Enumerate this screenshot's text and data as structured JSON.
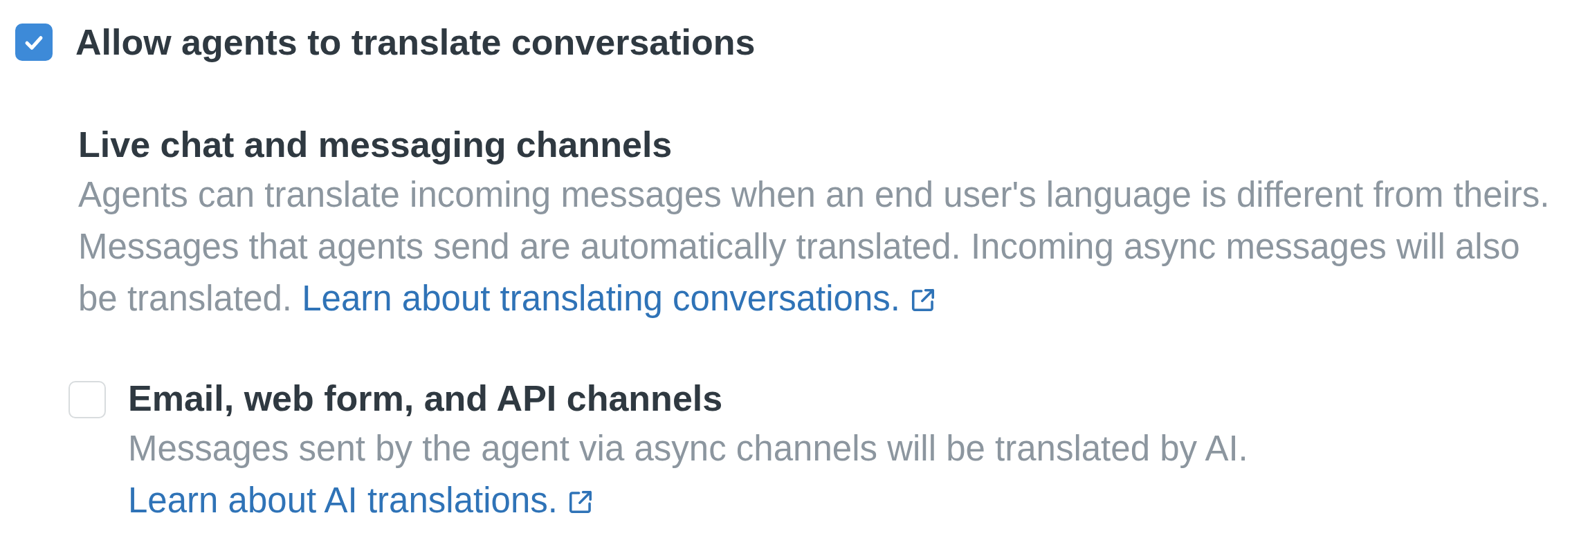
{
  "main_option": {
    "label": "Allow agents to translate conversations",
    "checked": true
  },
  "sections": [
    {
      "kind": "info",
      "heading": "Live chat and messaging channels",
      "description": "Agents can translate incoming messages when an end user's language is different from theirs. Messages that agents send are automatically translated. Incoming async messages will also be translated.",
      "link": "Learn about translating conversations."
    },
    {
      "kind": "checkbox",
      "checked": false,
      "heading": "Email, web form, and API channels",
      "description": "Messages sent by the agent via async channels will be translated by AI.",
      "link": "Learn about AI translations."
    }
  ]
}
